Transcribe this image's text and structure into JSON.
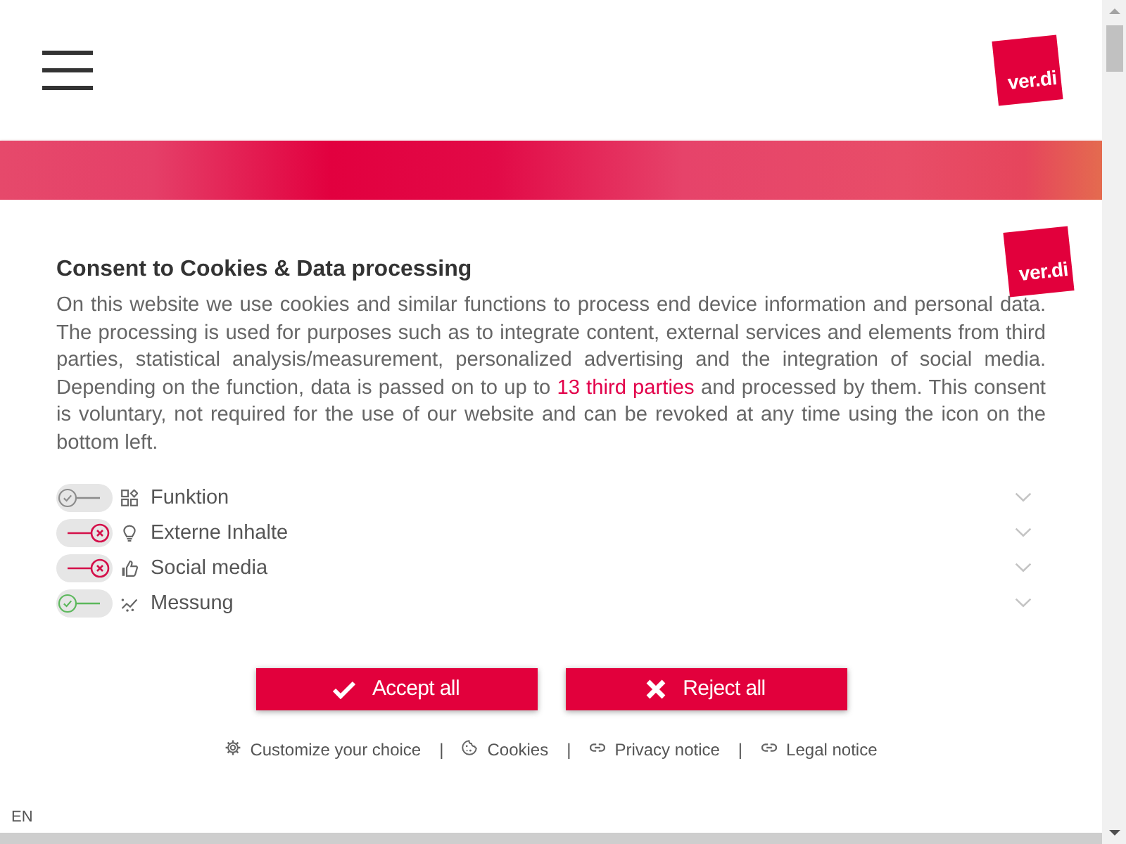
{
  "header": {
    "logo": "ver.di"
  },
  "consent": {
    "logo": "ver.di",
    "title": "Consent to Cookies & Data processing",
    "intro": {
      "before": "On this website we use cookies and similar functions to process end device information and personal data. The processing is used for purposes such as to integrate content, external services and elements from third parties, statistical analysis/measurement, personalized advertising and the integration of social media. Depending on the function, data is passed on to up to",
      "link": "13 third parties",
      "after": "and processed by them. This consent is voluntary, not required for the use of our website and can be revoked at any time using the icon on the bottom left."
    },
    "categories": [
      {
        "label": "Funktion",
        "accepted": true,
        "disabled": true,
        "expanded": false
      },
      {
        "label": "Externe Inhalte",
        "accepted": false,
        "disabled": false,
        "expanded": false
      },
      {
        "label": "Social media",
        "accepted": false,
        "disabled": false,
        "expanded": false
      },
      {
        "label": "Messung",
        "accepted": true,
        "disabled": false,
        "expanded": false
      }
    ],
    "buttons": [
      {
        "kind": "accept",
        "label": "Accept all"
      },
      {
        "kind": "reject",
        "label": "Reject all"
      }
    ],
    "footer_links": [
      {
        "kind": "link",
        "label": "Customize your choice"
      },
      {
        "kind": "separator",
        "label": "|"
      },
      {
        "kind": "link",
        "label": "Cookies"
      },
      {
        "kind": "separator",
        "label": "|"
      },
      {
        "kind": "link",
        "label": "Privacy notice"
      },
      {
        "kind": "separator",
        "label": "|"
      },
      {
        "kind": "link",
        "label": "Legal notice"
      }
    ],
    "language": "EN"
  }
}
